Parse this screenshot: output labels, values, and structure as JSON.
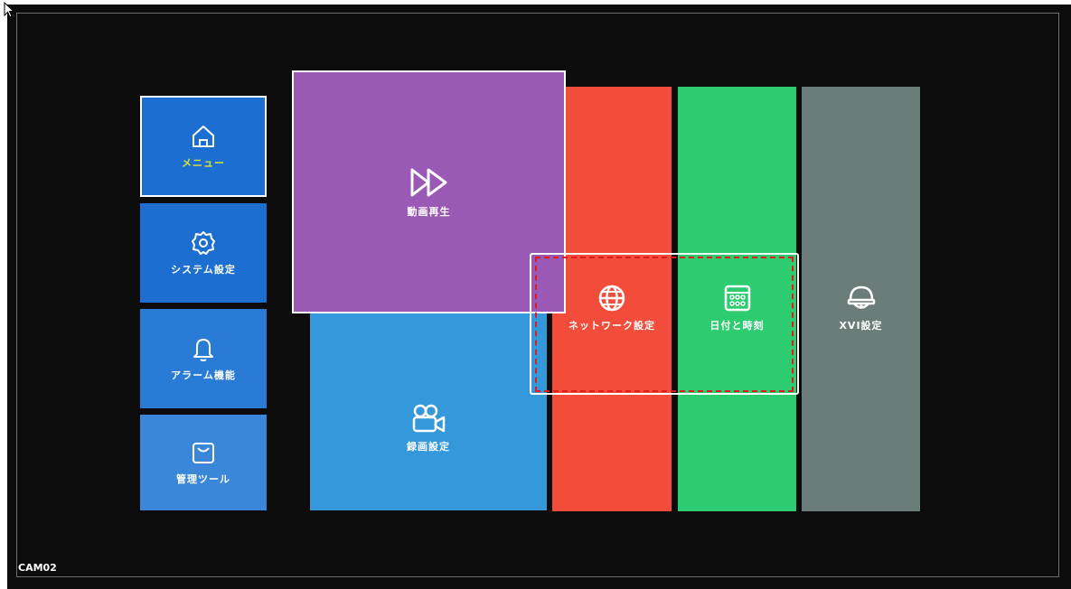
{
  "camera_label": "CAM02",
  "menu": {
    "home": {
      "label": "メニュー",
      "icon": "home-icon",
      "label_color": "#d8e23a",
      "bg": "#1c6fd1"
    },
    "system": {
      "label": "システム設定",
      "icon": "gear-icon",
      "bg": "#1c6fd1"
    },
    "alarm": {
      "label": "アラーム機能",
      "icon": "bell-icon",
      "bg": "#2a7bd6"
    },
    "tools": {
      "label": "管理ツール",
      "icon": "bag-icon",
      "bg": "#3a86d8"
    },
    "playback": {
      "label": "動画再生",
      "icon": "fast-forward-icon",
      "bg": "#9b59b6"
    },
    "recording": {
      "label": "録画設定",
      "icon": "video-camera-icon",
      "bg": "#3498db"
    },
    "network": {
      "label": "ネットワーク設定",
      "icon": "globe-icon",
      "bg": "#f24c3a"
    },
    "datetime": {
      "label": "日付と時刻",
      "icon": "calendar-icon",
      "bg": "#2ecc71"
    },
    "xvi": {
      "label": "XVI設定",
      "icon": "dome-camera-icon",
      "bg": "#6b7d78"
    }
  }
}
